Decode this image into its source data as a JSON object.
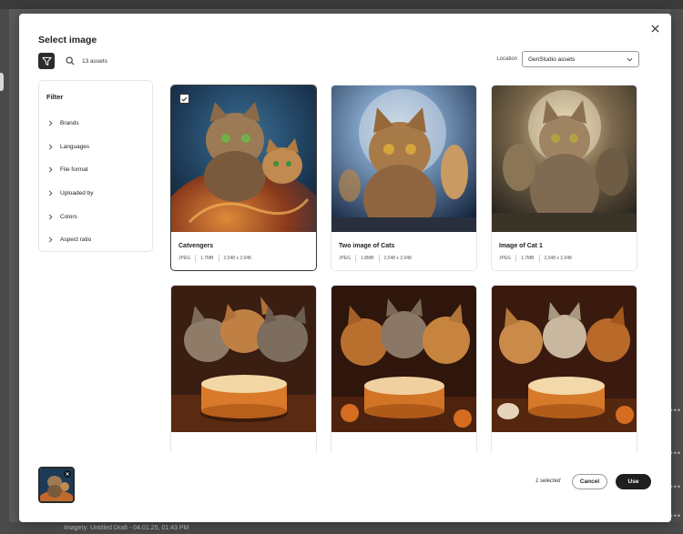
{
  "modal": {
    "title": "Select image",
    "asset_count": "13 assets",
    "location_label": "Location",
    "location_value": "GenStudio assets"
  },
  "filter": {
    "title": "Filter",
    "items": [
      {
        "label": "Brands"
      },
      {
        "label": "Languages"
      },
      {
        "label": "File format"
      },
      {
        "label": "Uploaded by"
      },
      {
        "label": "Colors"
      },
      {
        "label": "Aspect ratio"
      }
    ]
  },
  "assets": [
    {
      "title": "Catvengers",
      "format": "JPEG",
      "size": "1.7MB",
      "dimensions": "2,048 x 2,048",
      "selected": true
    },
    {
      "title": "Two image of Cats",
      "format": "JPEG",
      "size": "1.8MB",
      "dimensions": "2,048 x 2,048",
      "selected": false
    },
    {
      "title": "Image of Cat 1",
      "format": "JPEG",
      "size": "1.7MB",
      "dimensions": "2,048 x 2,048",
      "selected": false
    },
    {
      "title": "",
      "format": "",
      "size": "",
      "dimensions": "",
      "selected": false
    },
    {
      "title": "",
      "format": "",
      "size": "",
      "dimensions": "",
      "selected": false
    },
    {
      "title": "",
      "format": "",
      "size": "",
      "dimensions": "",
      "selected": false
    }
  ],
  "footer": {
    "selected_text": "1 selected",
    "cancel_label": "Cancel",
    "use_label": "Use"
  },
  "background": {
    "row_text": "Imagery: Untitled Draft - 04.01.25, 01:43 PM"
  },
  "colors": {
    "dark": "#1f1f1f",
    "overlay": "#5a5a5a"
  }
}
